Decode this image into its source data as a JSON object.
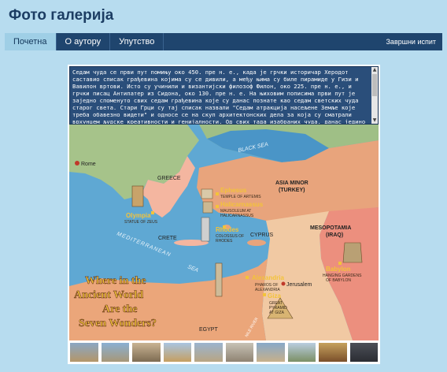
{
  "header": {
    "title": "Фото галерија"
  },
  "nav": {
    "items": [
      {
        "label": "Почетна",
        "active": true
      },
      {
        "label": "О аутору",
        "active": false
      },
      {
        "label": "Упутство",
        "active": false
      }
    ],
    "right_label": "Завршни испит"
  },
  "description": {
    "text": "Седам чуда се први пут помињу око 450. пре н. е., када је грчки историчар Херодот саставио списак грађевина којима су се дивили, а међу њима су биле пирамиде у Гизи и Вавилон вртови. Исто су учинили и византијски филозоф Филон, око 225. пре н. е., и грчки писац Антипатер из Сидона, око 130. пре н. е. На њиховим пописима први пут је заједно споменуто свих седам грађевина које су данас познате као седам светских чуда старог света. Стари Грци су тај списак назвали \"Седам атракција насељене Земље које треба обавезно видети\" и односе се на скуп архитектонских дела за која су сматрали врхунцем људске креативности и генијалности. Од свих тада изабраних чуда, данас једино можемо"
  },
  "map": {
    "labels": {
      "black_sea": "BLACK SEA",
      "rome": "Rome",
      "greece": "GREECE",
      "asia_minor": "ASIA MINOR",
      "asia_minor_sub": "(TURKEY)",
      "ephesus": "Ephesus",
      "ephesus_sub": "TEMPLE OF ARTEMIS",
      "halicarnassus": "Halicarnassus",
      "halicarnassus_sub1": "MAUSOLEUM AT",
      "halicarnassus_sub2": "HALICARNASSUS",
      "olympia": "Olympia",
      "olympia_sub": "STATUE OF ZEUS",
      "rhodes": "Rhodes",
      "rhodes_sub1": "COLOSSUS OF",
      "rhodes_sub2": "RHODES",
      "crete": "CRETE",
      "cyprus": "CYPRUS",
      "mesopotamia": "MESOPOTAMIA",
      "mesopotamia_sub": "(IRAQ)",
      "babylon": "Babylon",
      "babylon_sub1": "HANGING GARDENS",
      "babylon_sub2": "OF BABYLON",
      "alexandria": "Alexandria",
      "alexandria_sub1": "PHAROS OF",
      "alexandria_sub2": "ALEXANDRIA",
      "jerusalem": "Jerusalem",
      "giza": "Giza",
      "giza_sub1": "GREAT",
      "giza_sub2": "PYRAMID",
      "giza_sub3": "AT GIZA",
      "mediterranean": "MEDITERRANEAN",
      "sea": "SEA",
      "egypt": "EGYPT",
      "nile": "NILE RIVER",
      "headline1": "Where in the",
      "headline2": "Ancient World",
      "headline3": "Are the",
      "headline4": "Seven Wonders?"
    }
  },
  "thumbnails": [
    {
      "icon": "thumb-1"
    },
    {
      "icon": "thumb-2"
    },
    {
      "icon": "thumb-3"
    },
    {
      "icon": "thumb-4"
    },
    {
      "icon": "thumb-5"
    },
    {
      "icon": "thumb-6"
    },
    {
      "icon": "thumb-7"
    },
    {
      "icon": "thumb-8"
    },
    {
      "icon": "thumb-9"
    },
    {
      "icon": "thumb-10"
    }
  ],
  "colors": {
    "background": "#b7dcef",
    "nav": "#1f456e",
    "nav_active": "#9fcfe6",
    "title": "#1c3d63",
    "sea": "#5fa8d3",
    "land": "#e8a47c",
    "land_light": "#f1c9a3"
  }
}
